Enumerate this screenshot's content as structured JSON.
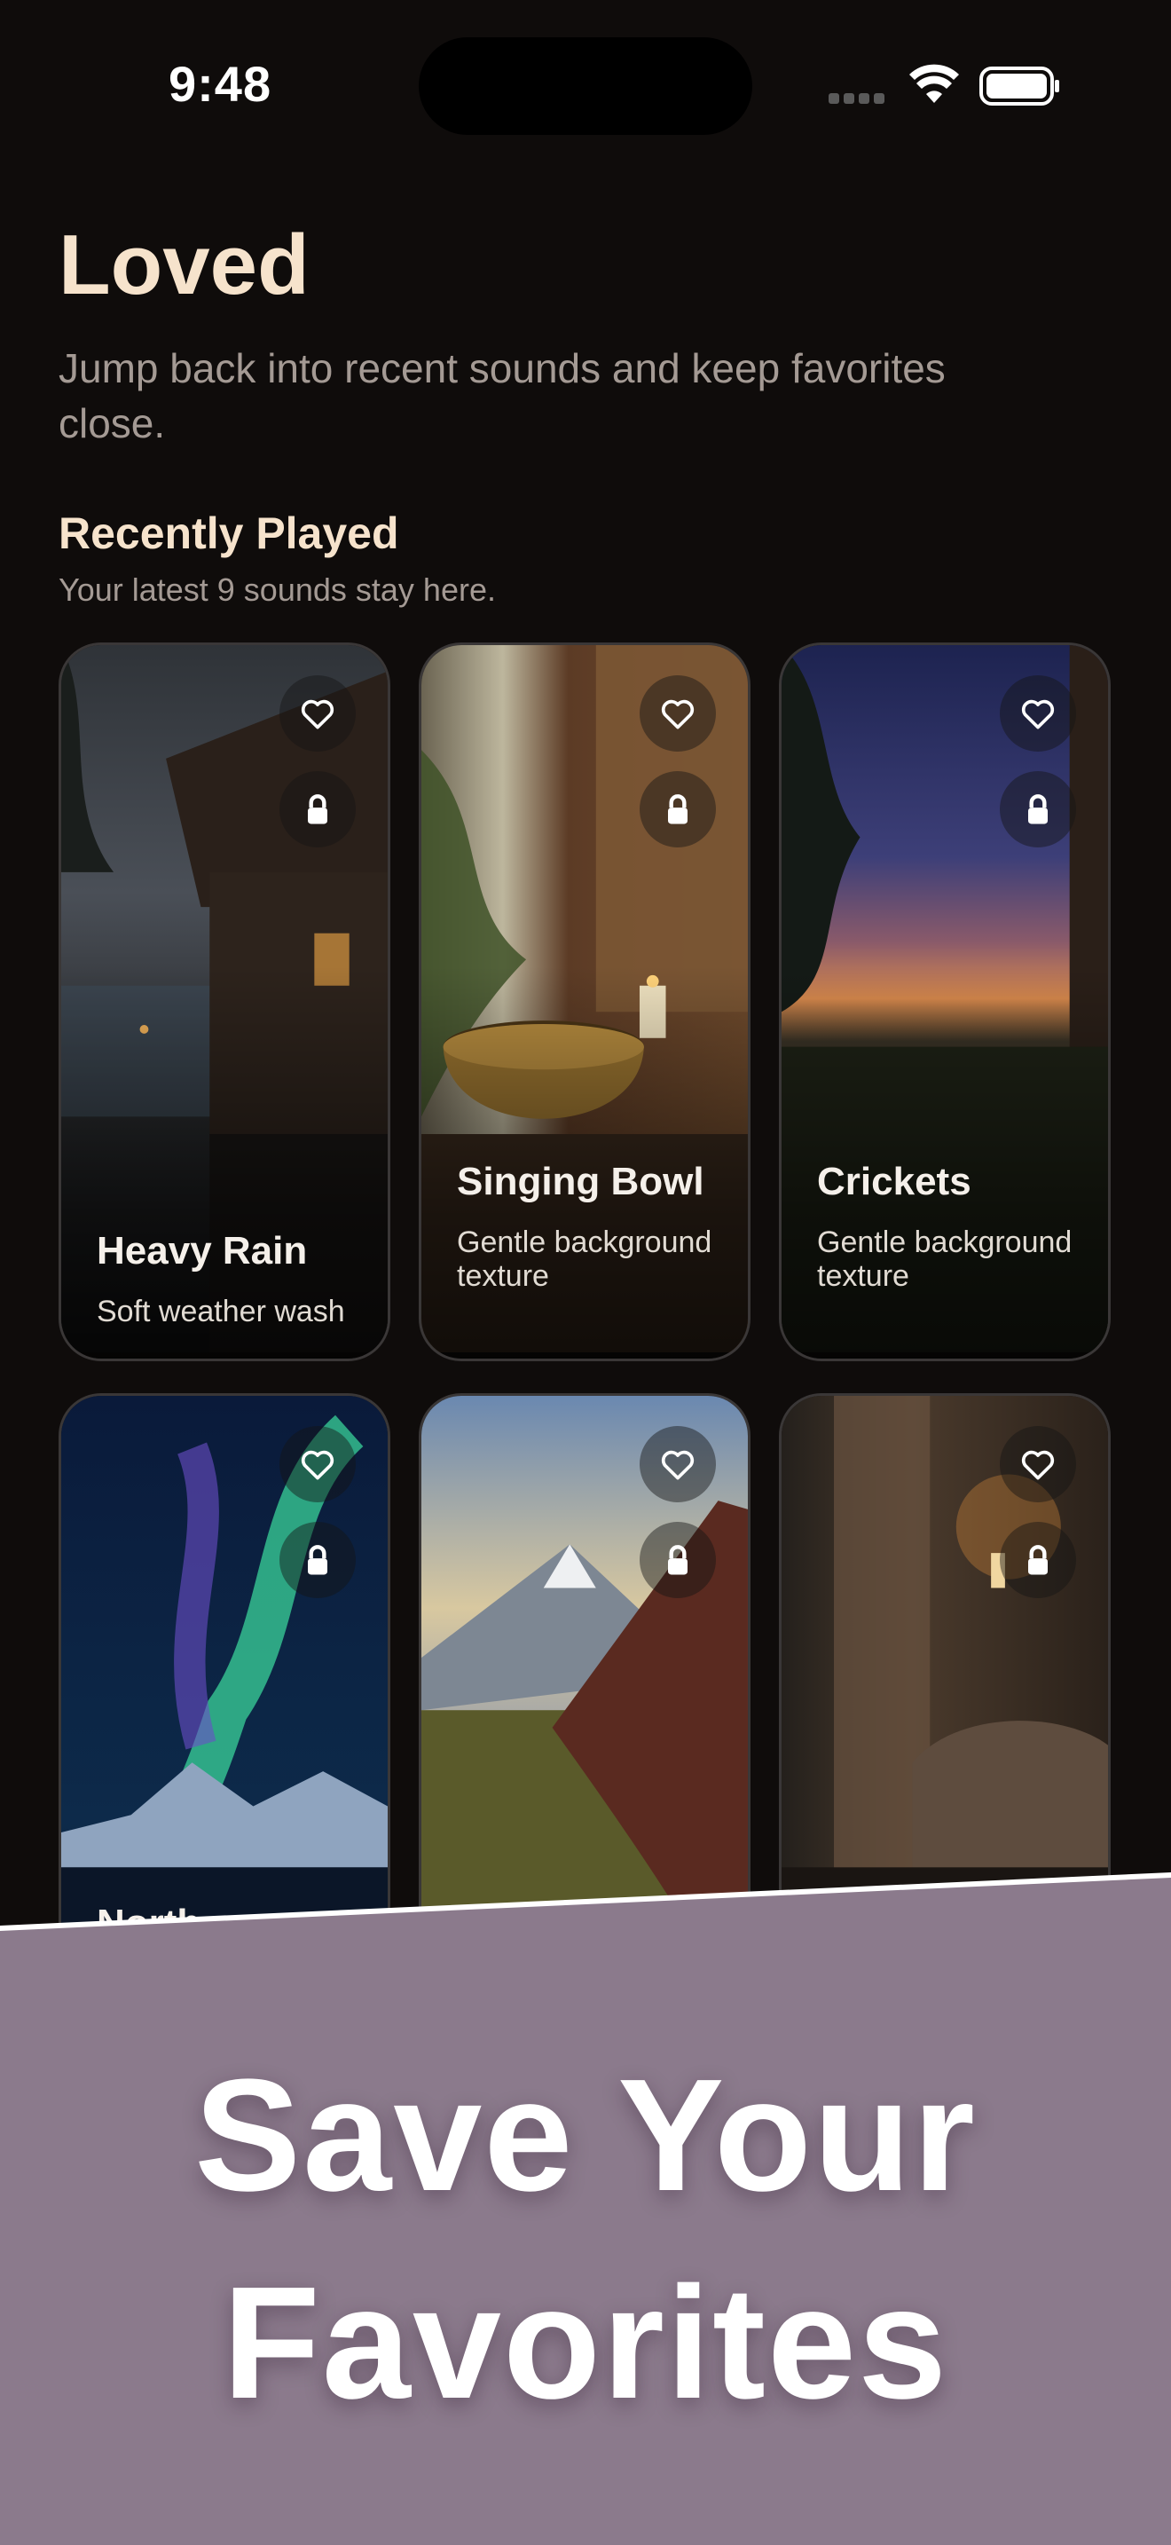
{
  "status_bar": {
    "time": "9:48"
  },
  "header": {
    "title": "Loved",
    "subtitle": "Jump back into recent sounds and keep favorites close."
  },
  "recent": {
    "title": "Recently Played",
    "subtitle": "Your latest 9 sounds stay here."
  },
  "cards": [
    {
      "name": "Heavy Rain",
      "desc": "Soft weather wash"
    },
    {
      "name": "Singing Bowl",
      "desc": "Gentle background texture"
    },
    {
      "name": "Crickets",
      "desc": "Gentle background texture"
    },
    {
      "name": "North"
    },
    {
      "name": ""
    },
    {
      "name": ""
    }
  ],
  "icons": {
    "favorite": "heart-icon",
    "locked": "lock-icon"
  },
  "promo": {
    "line1": "Save Your",
    "line2": "Favorites",
    "band_color": "#8b7a8c"
  }
}
